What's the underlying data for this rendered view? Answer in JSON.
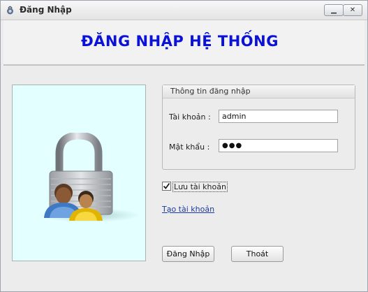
{
  "window": {
    "title": "Đăng Nhập",
    "minimize_icon": "minimize-icon",
    "close_icon": "close-icon"
  },
  "header": {
    "title": "ĐĂNG NHẬP HỆ THỐNG",
    "title_color": "#0a12d8"
  },
  "image_panel": {
    "icon": "lock-users-icon",
    "background": "#e3ffff"
  },
  "login_info": {
    "group_title": "Thông tin đăng nhập",
    "username_label": "Tài khoản :",
    "username_value": "admin",
    "password_label": "Mật khẩu :",
    "password_value": "●●●"
  },
  "remember": {
    "label": "Lưu tài khoản",
    "checked": true
  },
  "create_account_link": "Tạo tài khoản",
  "buttons": {
    "login": "Đăng Nhập",
    "exit": "Thoát"
  }
}
